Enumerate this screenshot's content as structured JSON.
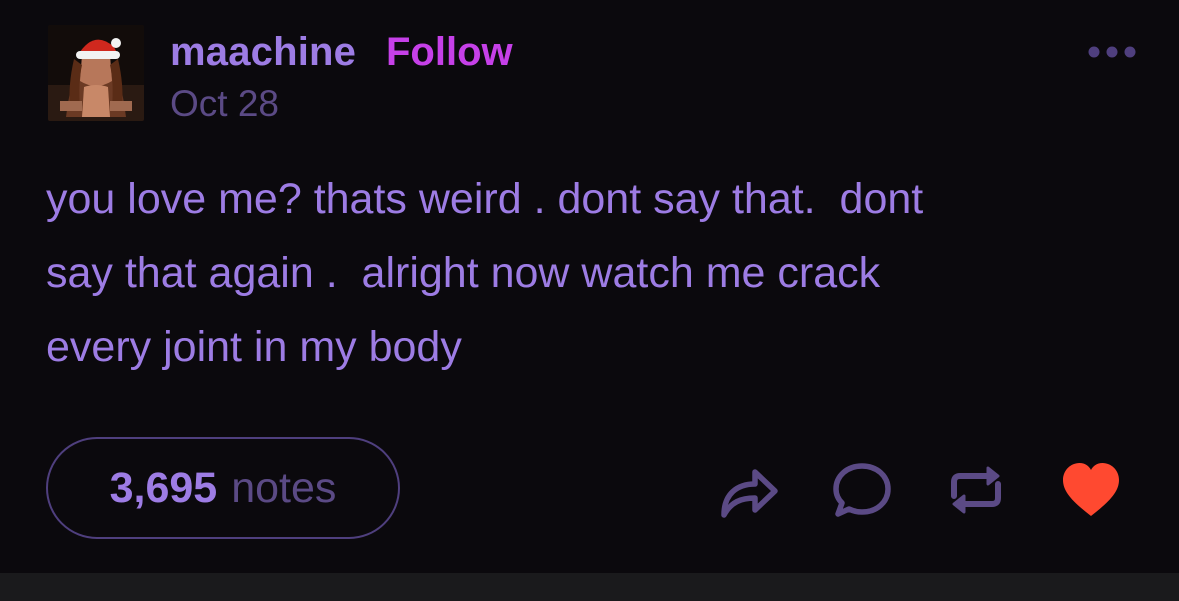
{
  "post": {
    "username": "maachine",
    "follow_label": "Follow",
    "date": "Oct 28",
    "body": "you love me? thats weird . dont say that.  dont\nsay that again .  alright now watch me crack\nevery joint in my body",
    "notes_count": "3,695",
    "notes_label": "notes"
  },
  "icons": {
    "avatar": "avatar-santa-hat-photo",
    "more": "more-options-icon",
    "share": "share-arrow-icon",
    "reply": "reply-bubble-icon",
    "reblog": "reblog-icon",
    "like": "heart-icon"
  },
  "colors": {
    "background": "#0b090d",
    "text_accent": "#9d7ce4",
    "follow": "#c640e8",
    "muted": "#5b4a85",
    "heart": "#ff4930"
  }
}
